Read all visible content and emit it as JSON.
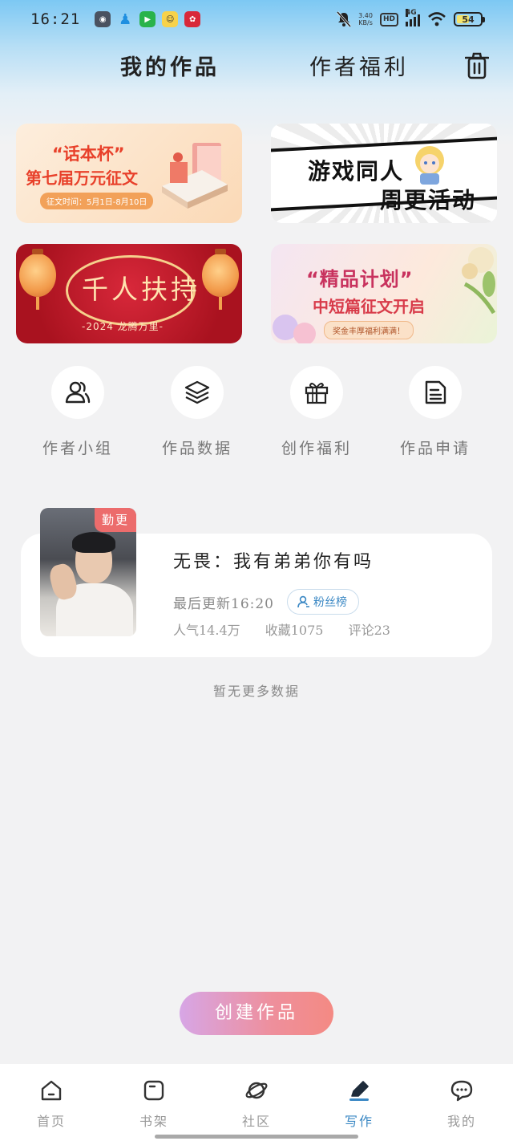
{
  "status_bar": {
    "time": "16:21",
    "net_speed_value": "3.40",
    "net_speed_unit": "KB/s",
    "hd": "HD",
    "network": "4G",
    "battery": "54",
    "battery_level_percent": 54
  },
  "header": {
    "tabs": [
      {
        "label": "我的作品",
        "active": true
      },
      {
        "label": "作者福利",
        "active": false
      }
    ],
    "trash_icon": "trash-icon"
  },
  "banners": [
    {
      "title": "“话本杯”",
      "subtitle": "第七届万元征文",
      "date": "征文时间：5月1日-8月10日"
    },
    {
      "title": "游戏同人",
      "subtitle": "周更活动"
    },
    {
      "title": "千人扶持",
      "subtitle": "-2024 龙腾万里-"
    },
    {
      "title": "“精品计划”",
      "subtitle": "中短篇征文开启",
      "note": "奖金丰厚福利满满！"
    }
  ],
  "quick_actions": [
    {
      "label": "作者小组",
      "icon": "people-icon"
    },
    {
      "label": "作品数据",
      "icon": "layers-icon"
    },
    {
      "label": "创作福利",
      "icon": "gift-icon"
    },
    {
      "label": "作品申请",
      "icon": "document-icon"
    }
  ],
  "work": {
    "tag": "勤更",
    "title": "无畏：我有弟弟你有吗",
    "last_update": "最后更新16:20",
    "fans_button": "粉丝榜",
    "popularity": "人气14.4万",
    "favorites": "收藏1075",
    "comments": "评论23"
  },
  "no_more": "暂无更多数据",
  "create_button": "创建作品",
  "bottom_nav": [
    {
      "label": "首页",
      "icon": "home-icon",
      "active": false
    },
    {
      "label": "书架",
      "icon": "bookshelf-icon",
      "active": false
    },
    {
      "label": "社区",
      "icon": "planet-icon",
      "active": false
    },
    {
      "label": "写作",
      "icon": "pen-icon",
      "active": true
    },
    {
      "label": "我的",
      "icon": "chat-icon",
      "active": false
    }
  ],
  "colors": {
    "accent": "#3b88c4",
    "tag": "#ec6c6c",
    "create_gradient_start": "#d7a6e6",
    "create_gradient_end": "#f48a83"
  }
}
